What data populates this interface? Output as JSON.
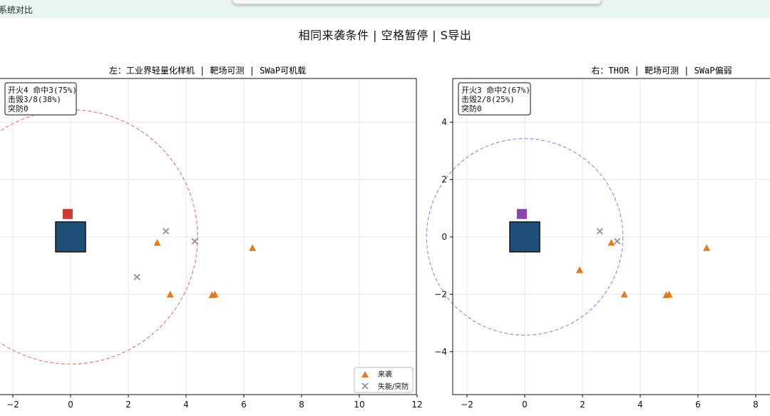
{
  "window": {
    "title": "系统对比"
  },
  "figure": {
    "suptitle": "相同来袭条件 | 空格暂停 | S导出"
  },
  "colors": {
    "threat": "#e07b22",
    "neutralized": "#999999",
    "platform": "#1f4e79",
    "left_sensor": "#cc3b2e",
    "right_sensor": "#8e44ad",
    "left_range": "#e0837a",
    "right_range": "#9b8fe0",
    "grid": "#e6e6e6"
  },
  "legend": {
    "threat": "来袭",
    "neutralized": "失能/突防"
  },
  "chart_data": [
    {
      "type": "scatter",
      "title": "左：工业界轻量化样机 | 靶场可测 | SWaP可机载",
      "xlim": [
        -2.5,
        12
      ],
      "ylim": [
        -5.5,
        5.5
      ],
      "xticks": [
        -2,
        0,
        2,
        4,
        6,
        8,
        10,
        12
      ],
      "yticks": [],
      "grid": true,
      "legend_position": "lower-right",
      "stats": [
        "开火4 命中3(75%)",
        "击毁3/8(38%)",
        "突防0"
      ],
      "platform": {
        "x": 0,
        "y": 0
      },
      "sensor": {
        "x": -0.1,
        "y": 0.8
      },
      "range_radius": 4.4,
      "series": [
        {
          "name": "来袭",
          "marker": "triangle",
          "points": [
            [
              3.0,
              -0.2
            ],
            [
              6.3,
              -0.38
            ],
            [
              3.45,
              -2.0
            ],
            [
              4.9,
              -2.02
            ],
            [
              5.0,
              -2.0
            ]
          ]
        },
        {
          "name": "失能/突防",
          "marker": "x",
          "points": [
            [
              3.3,
              0.2
            ],
            [
              4.3,
              -0.15
            ],
            [
              2.3,
              -1.4
            ]
          ]
        }
      ]
    },
    {
      "type": "scatter",
      "title": "右：THOR | 靶场可测 | SWaP偏弱",
      "xlim": [
        -2.5,
        8.5
      ],
      "ylim": [
        -5.5,
        5.5
      ],
      "xticks": [
        -2,
        0,
        2,
        4,
        6,
        8
      ],
      "yticks": [
        4,
        2,
        0,
        -2,
        -4
      ],
      "grid": true,
      "legend_position": "",
      "stats": [
        "开火3 命中2(67%)",
        "击毁2/8(25%)",
        "突防0"
      ],
      "platform": {
        "x": 0,
        "y": 0
      },
      "sensor": {
        "x": -0.1,
        "y": 0.8
      },
      "range_radius": 3.4,
      "series": [
        {
          "name": "来袭",
          "marker": "triangle",
          "points": [
            [
              1.9,
              -1.15
            ],
            [
              3.0,
              -0.2
            ],
            [
              6.3,
              -0.38
            ],
            [
              3.45,
              -2.0
            ],
            [
              4.9,
              -2.02
            ],
            [
              5.0,
              -2.0
            ]
          ]
        },
        {
          "name": "失能/突防",
          "marker": "x",
          "points": [
            [
              2.6,
              0.2
            ],
            [
              3.2,
              -0.15
            ]
          ]
        }
      ]
    }
  ]
}
